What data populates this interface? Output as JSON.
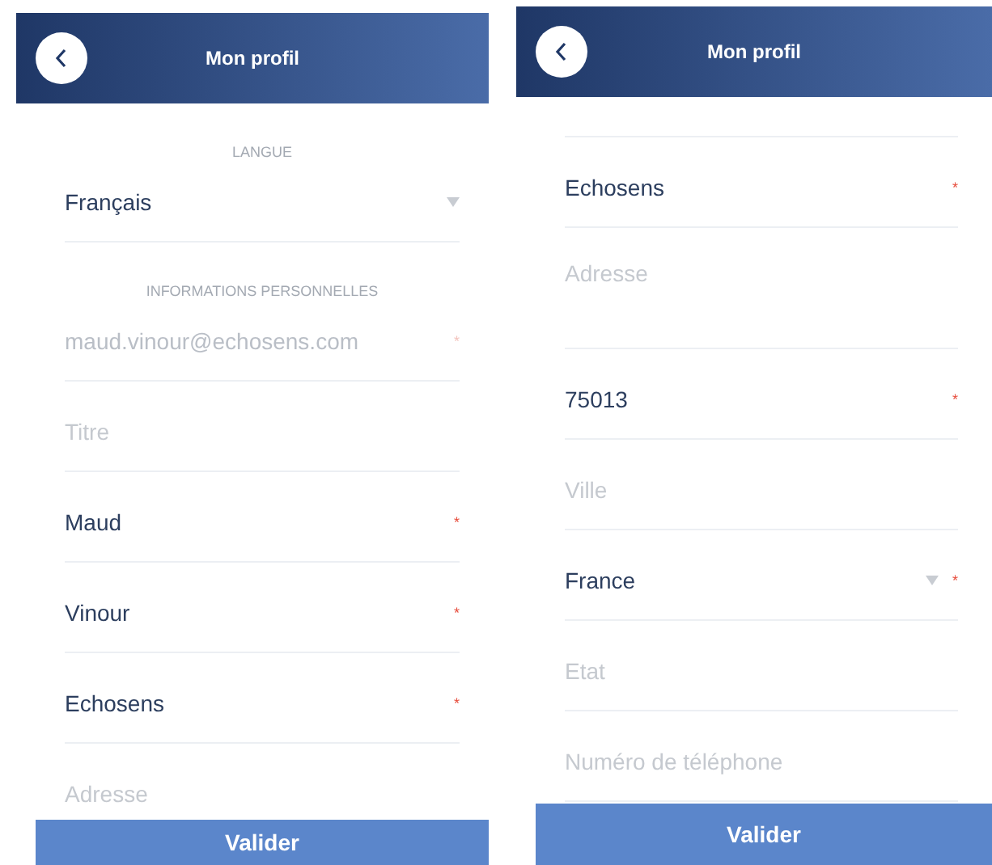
{
  "screens": [
    {
      "title": "Mon profil",
      "scrolled": false,
      "submit": "Valider",
      "items": [
        {
          "kind": "section",
          "label": "LANGUE"
        },
        {
          "kind": "select",
          "value": "Français"
        },
        {
          "kind": "section",
          "label": "INFORMATIONS PERSONNELLES"
        },
        {
          "kind": "field",
          "value": "maud.vinour@echosens.com",
          "asterisk": "*",
          "disabled": true
        },
        {
          "kind": "field",
          "placeholder": "Titre"
        },
        {
          "kind": "field",
          "value": "Maud",
          "asterisk": "*"
        },
        {
          "kind": "field",
          "value": "Vinour",
          "asterisk": "*"
        },
        {
          "kind": "field",
          "value": "Echosens",
          "asterisk": "*"
        },
        {
          "kind": "field",
          "placeholder": "Adresse"
        }
      ]
    },
    {
      "title": "Mon profil",
      "scrolled": true,
      "submit": "Valider",
      "items": [
        {
          "kind": "field",
          "value": "Echosens",
          "asterisk": "*"
        },
        {
          "kind": "textarea",
          "placeholder": "Adresse"
        },
        {
          "kind": "field",
          "value": "75013",
          "asterisk": "*"
        },
        {
          "kind": "field",
          "placeholder": "Ville"
        },
        {
          "kind": "select",
          "value": "France",
          "asterisk": "*"
        },
        {
          "kind": "field",
          "placeholder": "Etat"
        },
        {
          "kind": "field",
          "placeholder": "Numéro de téléphone"
        }
      ]
    }
  ]
}
